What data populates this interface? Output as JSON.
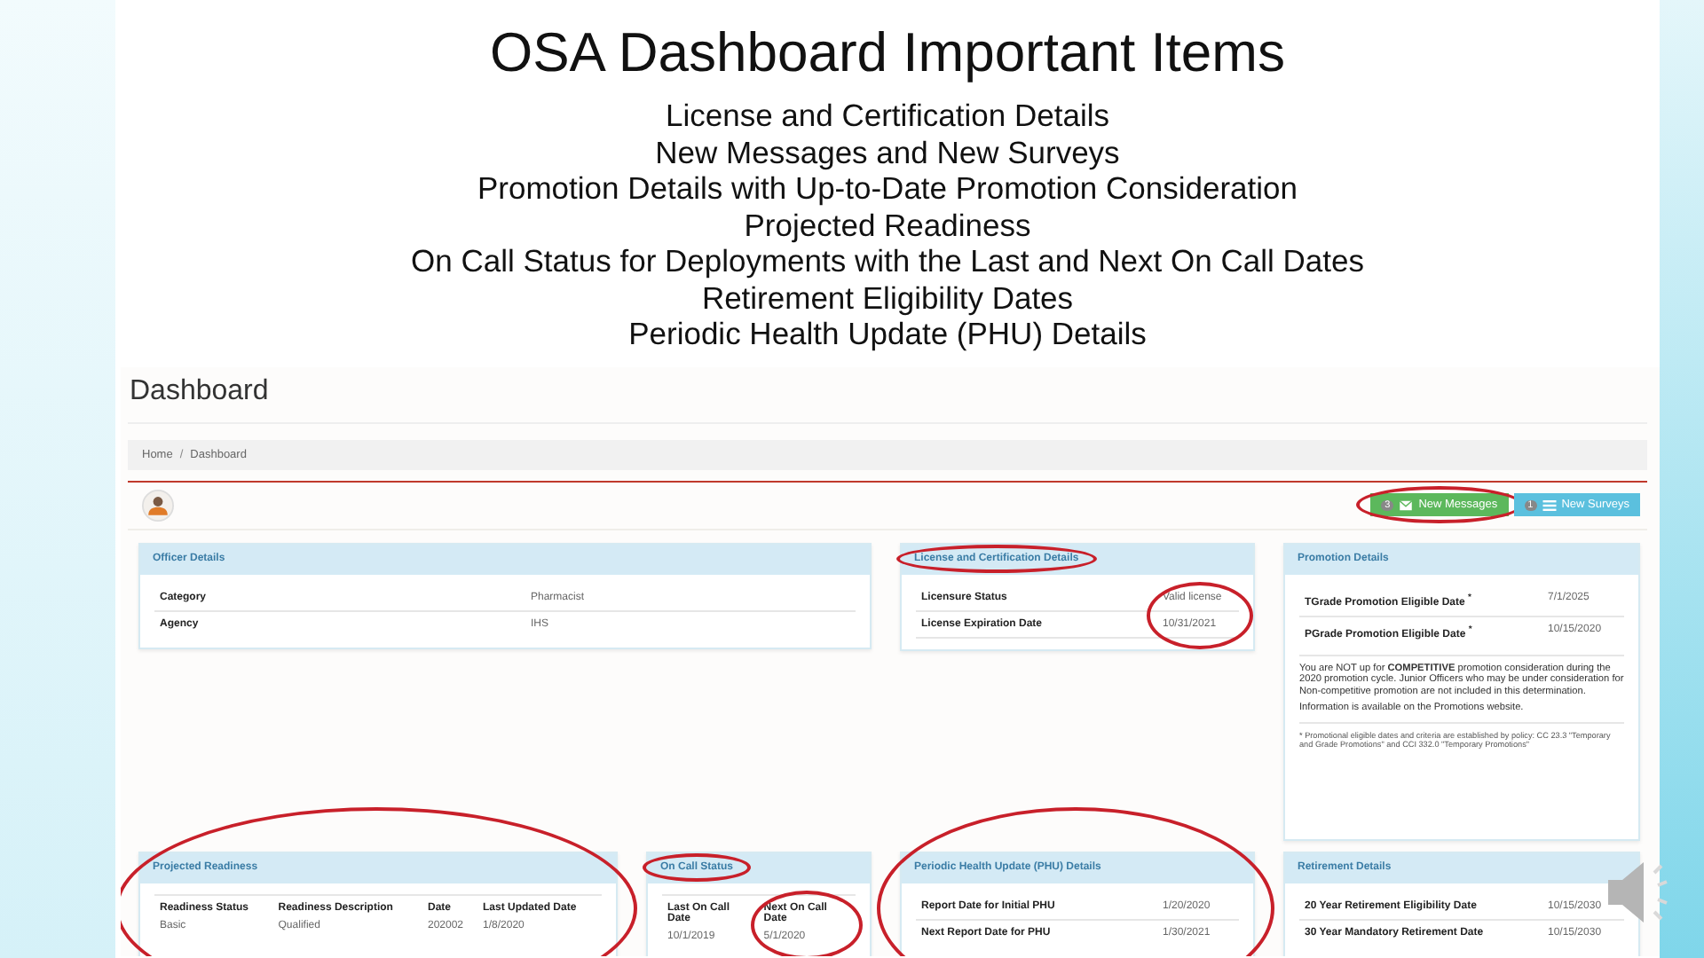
{
  "slide": {
    "title": "OSA Dashboard Important Items",
    "bullets": [
      "License and Certification Details",
      "New Messages and New Surveys",
      "Promotion Details with Up-to-Date Promotion Consideration",
      "Projected Readiness",
      "On Call Status for Deployments with the Last and Next On Call Dates",
      "Retirement Eligibility Dates",
      "Periodic Health Update (PHU) Details"
    ]
  },
  "dashboard": {
    "title": "Dashboard",
    "breadcrumb": [
      "Home",
      "Dashboard"
    ],
    "breadcrumb_separator": "/",
    "buttons": [
      {
        "kind": "messages",
        "count": "3",
        "label": "New Messages",
        "circled": true
      },
      {
        "kind": "surveys",
        "count": "1",
        "label": "New Surveys",
        "circled": false
      }
    ],
    "cards": [
      {
        "kind": "kv",
        "title": "Officer Details",
        "title_circled": false,
        "circled": false,
        "values_circled": false,
        "rows": [
          {
            "label": "Category",
            "value": "Pharmacist"
          },
          {
            "label": "Agency",
            "value": "IHS"
          }
        ]
      },
      {
        "kind": "kv",
        "title": "License and Certification Details",
        "title_circled": true,
        "circled": false,
        "values_circled": true,
        "rows": [
          {
            "label": "Licensure Status",
            "value": "Valid license"
          },
          {
            "label": "License Expiration Date",
            "value": "10/31/2021"
          }
        ]
      },
      {
        "kind": "promotion",
        "title": "Promotion Details",
        "title_circled": false,
        "circled": false,
        "rows": [
          {
            "label": "TGrade Promotion Eligible Date $^{*}$",
            "value": "7/1/2025"
          },
          {
            "label": "PGrade Promotion Eligible Date $^{*}$",
            "value": "10/15/2020"
          }
        ],
        "notice": "You are NOT up for **COMPETITIVE** promotion consideration during the 2020 promotion cycle. Junior Officers who may be under consideration for Non-competitive promotion are not included in this determination.",
        "info": "Information is available on the Promotions website.",
        "footnote": "* Promotional eligible dates and criteria are established by policy: CC 23.3 \"Temporary and Grade Promotions\" and CCI 332.0 \"Temporary Promotions\""
      },
      {
        "kind": "table",
        "title": "Projected Readiness",
        "title_circled": false,
        "circled": true,
        "columns": [
          {
            "label": "Readiness Status",
            "circled": false
          },
          {
            "label": "Readiness Description",
            "circled": false
          },
          {
            "label": "Date",
            "circled": false
          },
          {
            "label": "Last Updated Date",
            "circled": false
          }
        ],
        "rows": [
          [
            "Basic",
            "Qualified",
            "202002",
            "1/8/2020"
          ]
        ]
      },
      {
        "kind": "table",
        "title": "On Call Status",
        "title_circled": true,
        "circled": false,
        "columns": [
          {
            "label": "Last On Call Date",
            "circled": false
          },
          {
            "label": "Next On Call Date",
            "circled": true
          }
        ],
        "rows": [
          [
            "10/1/2019",
            "5/1/2020"
          ]
        ]
      },
      {
        "kind": "kv",
        "title": "Periodic Health Update (PHU) Details",
        "title_circled": false,
        "circled": true,
        "values_circled": false,
        "rows": [
          {
            "label": "Report Date for Initial PHU",
            "value": "1/20/2020"
          },
          {
            "label": "Next Report Date for PHU",
            "value": "1/30/2021"
          }
        ]
      },
      {
        "kind": "kv",
        "title": "Retirement Details",
        "title_circled": false,
        "circled": false,
        "values_circled": false,
        "rows": [
          {
            "label": "20 Year Retirement Eligibility Date",
            "value": "10/15/2030"
          },
          {
            "label": "30 Year Mandatory Retirement Date",
            "value": "10/15/2030"
          }
        ]
      }
    ]
  }
}
